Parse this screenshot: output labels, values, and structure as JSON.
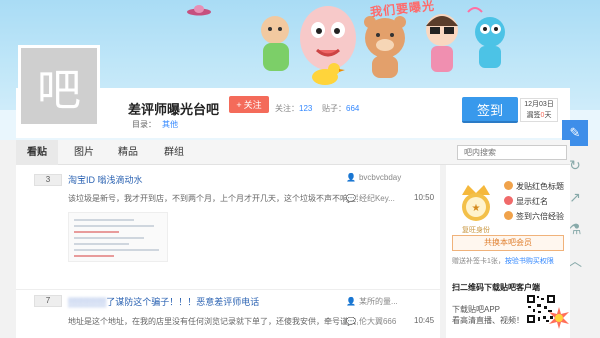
{
  "banner": {
    "slogan": "我们要曝光"
  },
  "avatar": {
    "glyph": "吧"
  },
  "forum": {
    "name": "差评师曝光台吧",
    "follow_label": "关注",
    "follow_count_label": "关注：",
    "follow_count": "123",
    "posts_label": "贴子：",
    "posts_count": "664",
    "catalog_label": "目录：",
    "catalog_value": "其他"
  },
  "signin": {
    "button_label": "签到",
    "date": "12月03日",
    "status_prefix": "漏签",
    "status_days": "0",
    "status_suffix": "天"
  },
  "side_tools": [
    {
      "name": "edit-icon",
      "glyph": "✎"
    },
    {
      "name": "refresh-icon",
      "glyph": "↻"
    },
    {
      "name": "share-icon",
      "glyph": "↗"
    },
    {
      "name": "flask-icon",
      "glyph": "⚗"
    },
    {
      "name": "chevron-up-icon",
      "glyph": "︿"
    }
  ],
  "nav": {
    "tabs": [
      "看贴",
      "图片",
      "精品",
      "群组"
    ],
    "search_placeholder": "吧内搜索"
  },
  "threads": [
    {
      "reply_count": "3",
      "title": "淘宝ID 嗡浅滴动水",
      "author": "bvcbvcbday",
      "excerpt": "该垃圾是新号，我才开到店，不到两个月，上个月才开几天，这个垃圾不声不响在我…",
      "last_reply": "经纪Key...",
      "time": "10:50"
    },
    {
      "reply_count": "7",
      "title": "了谋防这个骗子！！！恶意差评师电话",
      "author": "某所的量...",
      "excerpt": "地址是这个地址，在我的店里没有任何浏览记录就下单了，还傻我安供，牵号谨慎，…",
      "last_reply": "伦大翼666",
      "time": "10:45"
    }
  ],
  "aside": {
    "vip_label": "复旺身份",
    "privileges": [
      "发贴红色标题",
      "显示红名",
      "签到六倍经验"
    ],
    "vip_button": "共换本吧会员",
    "note_prefix": "赠送补签卡1张，",
    "note_link": "按验书购买权限",
    "qr_title": "扫二维码下载贴吧客户端",
    "qr_line1": "下载贴吧APP",
    "qr_line2": "看高清直播、视频！"
  }
}
